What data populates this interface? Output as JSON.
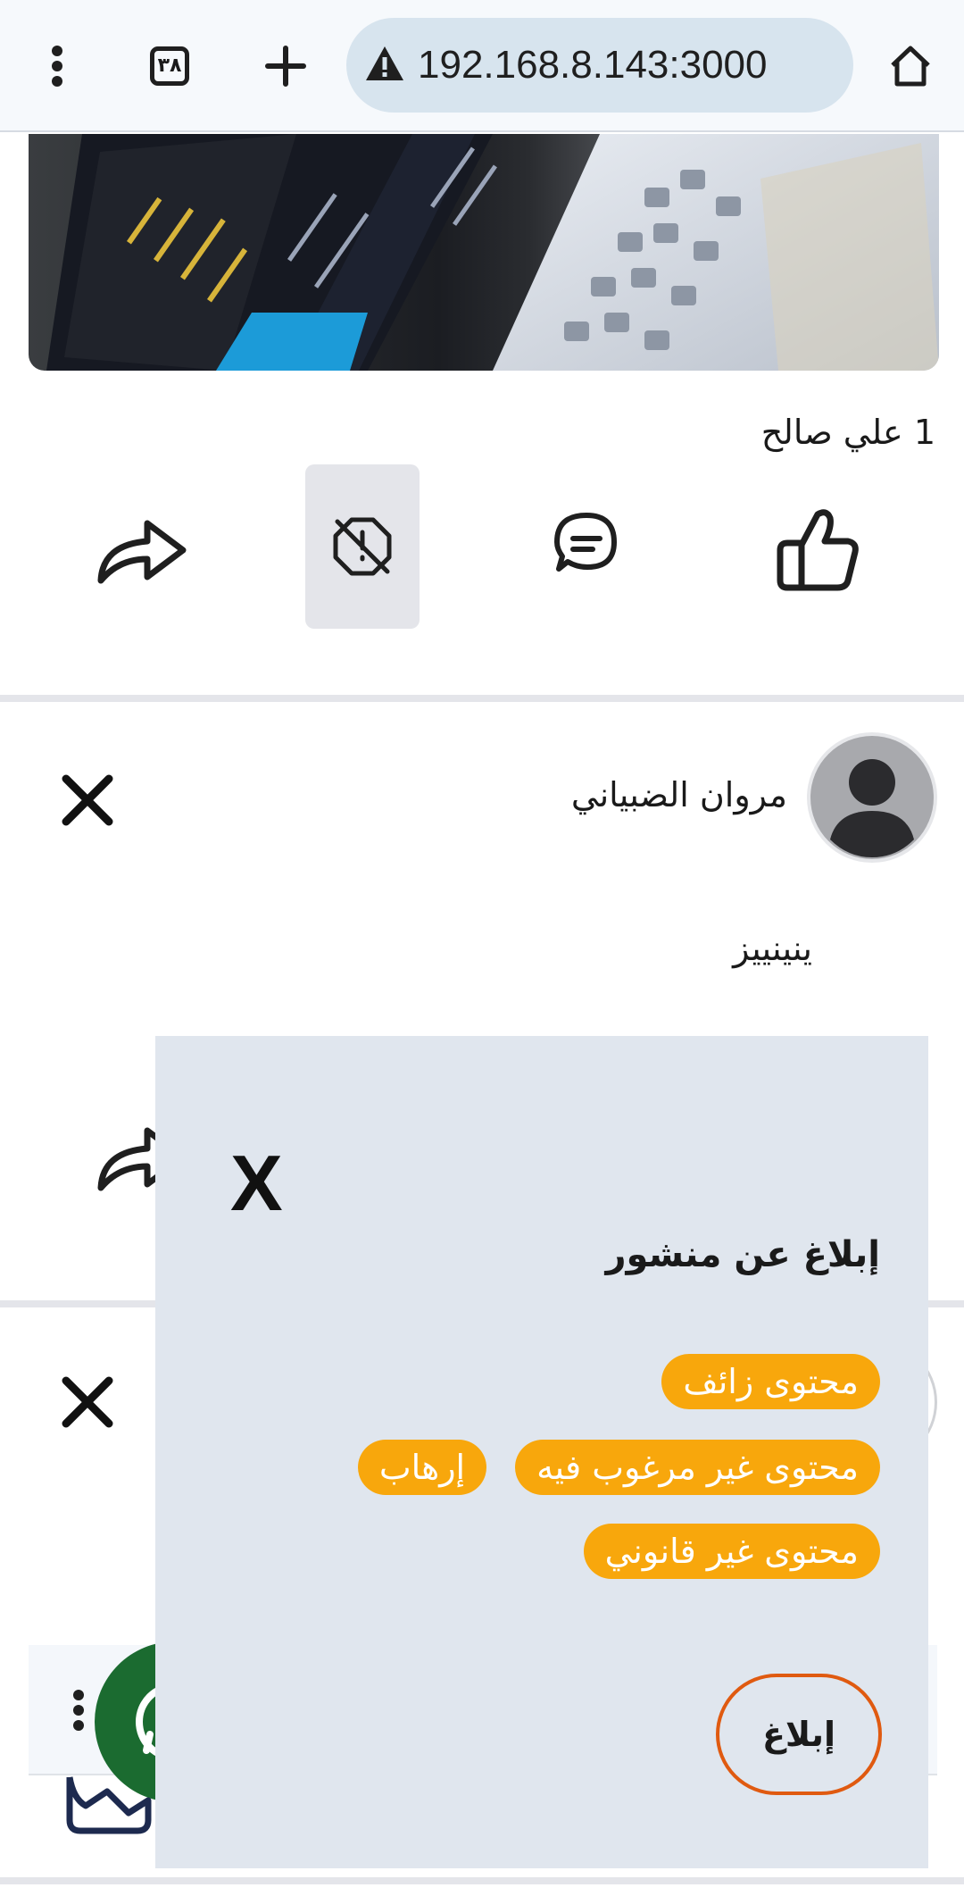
{
  "browser": {
    "menu_icon": "more-vert-icon",
    "tab_count": "٣٨",
    "new_tab_icon": "plus-icon",
    "security_icon": "warning-icon",
    "url": "192.168.8.143:3000",
    "home_icon": "home-icon"
  },
  "post1": {
    "likes_text": "1 علي صالح",
    "actions": [
      "like-icon",
      "comment-icon",
      "report-icon",
      "share-icon"
    ]
  },
  "post2": {
    "author_name": "مروان الضبياني",
    "body_text": "ينينييز"
  },
  "report_modal": {
    "close_label": "X",
    "title": "إبلاغ عن منشور",
    "options": [
      "محتوى زائف",
      "محتوى غير مرغوب فيه",
      "إرهاب",
      "محتوى غير قانوني"
    ],
    "submit_label": "إبلاغ"
  },
  "colors": {
    "chip": "#f8a70c",
    "modal_bg": "#e0e6ee",
    "submit_border": "#e05a10",
    "whatsapp_green": "#1b6b30"
  }
}
